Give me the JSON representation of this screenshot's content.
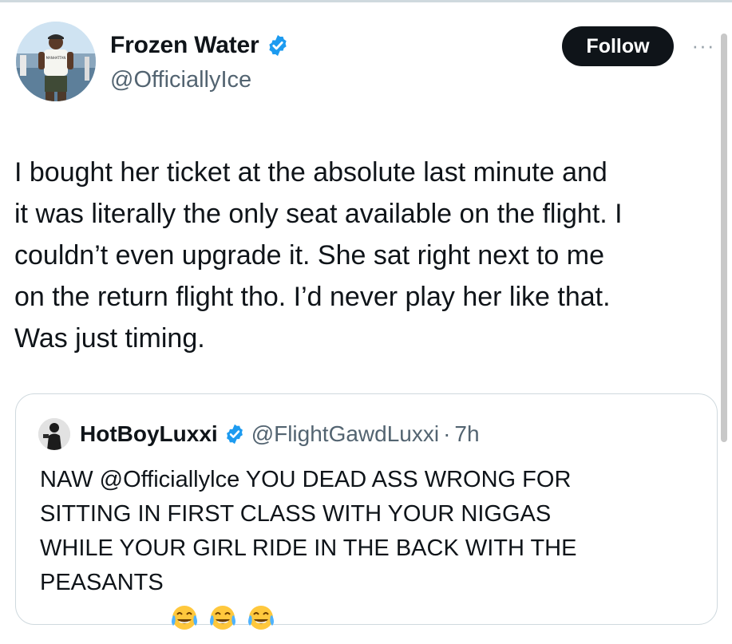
{
  "author": {
    "display_name": "Frozen Water",
    "handle": "@OfficiallyIce",
    "avatar_icon": "profile-photo-man-white-tshirt",
    "verified_icon": "verified-badge-icon",
    "avatar_shirt_text": "MANHATTAN"
  },
  "actions": {
    "follow_label": "Follow",
    "more_label": "···"
  },
  "tweet": {
    "text": "I bought her ticket at the absolute last minute and\nit was literally the only seat available on the flight. I\ncouldn’t even upgrade it. She sat right next to me\non the return flight tho. I’d never play her like that.\nWas just timing."
  },
  "quoted": {
    "display_name": "HotBoyLuxxi",
    "handle": "@FlightGawdLuxxi",
    "separator": "·",
    "time": "7h",
    "text": "NAW @Officiallylce YOU DEAD ASS WRONG FOR\nSITTING IN FIRST CLASS WITH YOUR NIGGAS\nWHILE YOUR GIRL RIDE IN THE BACK WITH THE\nPEASANTS",
    "emojis": [
      "tears-of-joy-emoji",
      "tears-of-joy-emoji",
      "tears-of-joy-emoji"
    ]
  },
  "colors": {
    "verified_blue": "#1d9bf0",
    "follow_bg": "#0f1419",
    "secondary_text": "#536471",
    "border": "#cfd9de"
  }
}
